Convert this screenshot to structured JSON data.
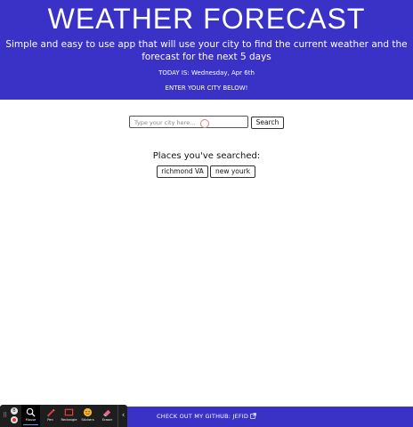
{
  "header": {
    "title": "WEATHER FORECAST",
    "subtitle": "Simple and easy to use app that will use your city to find the current weather and the forecast for the next 5 days",
    "today": "TODAY IS: Wednesday, Apr 6th",
    "prompt": "ENTER YOUR CITY BELOW!"
  },
  "search": {
    "placeholder": "Type your city here...",
    "button_label": "Search"
  },
  "history": {
    "title": "Places you've searched:",
    "items": [
      "richmond VA",
      "new yourk"
    ]
  },
  "footer": {
    "github_label": "CHECK OUT MY GITHUB: JEFID"
  },
  "toolbar": {
    "tools": [
      {
        "label": "Mouse",
        "icon": "mouse-cursor-icon",
        "active": true
      },
      {
        "label": "Pen",
        "icon": "pen-icon"
      },
      {
        "label": "Rectangle",
        "icon": "rectangle-icon"
      },
      {
        "label": "Stickers",
        "icon": "sticker-icon"
      },
      {
        "label": "Eraser",
        "icon": "eraser-icon"
      }
    ],
    "side_badge": "B"
  },
  "colors": {
    "brand": "#3a31c7",
    "toolbar_bg": "#1e1e1e",
    "accent": "#3ea9f5"
  }
}
